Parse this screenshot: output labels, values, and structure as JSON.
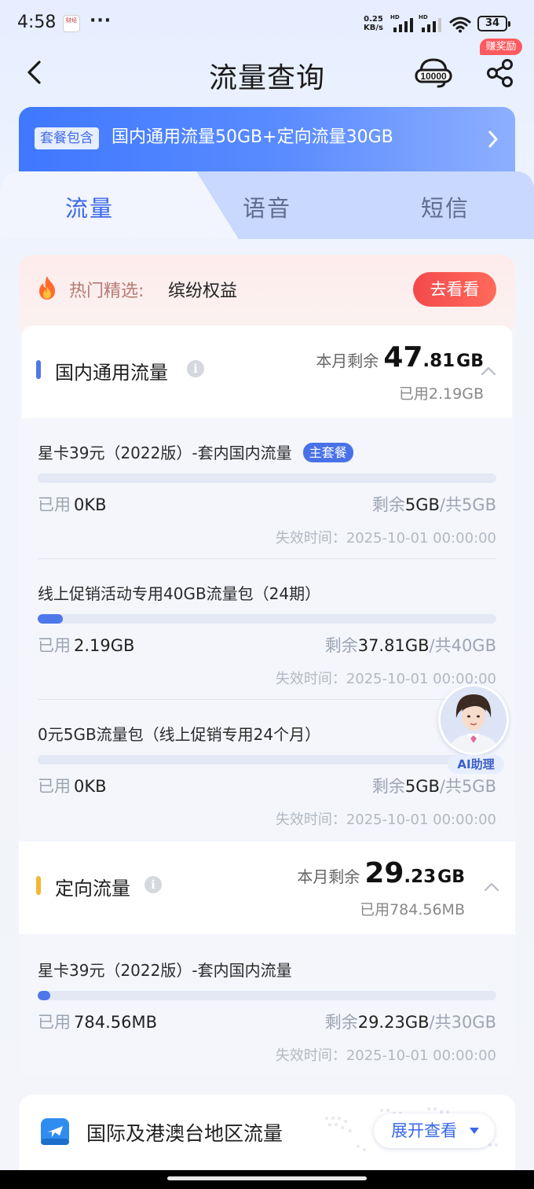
{
  "status_bar": {
    "time": "4:58",
    "more": "···",
    "app_icon_text": "财经",
    "net_speed_value": "0.25",
    "net_speed_unit": "KB/s",
    "sim1_label": "HD",
    "sim2_label": "HD",
    "battery": "34"
  },
  "nav": {
    "title": "流量查询",
    "service_icon": "10000-service-icon",
    "reward_badge": "赚奖励"
  },
  "package": {
    "tag": "套餐包含",
    "text": "国内通用流量50GB+定向流量30GB"
  },
  "tabs": [
    {
      "label": "流量",
      "active": true
    },
    {
      "label": "语音",
      "active": false
    },
    {
      "label": "短信",
      "active": false
    }
  ],
  "hot_pick": {
    "label": "热门精选:",
    "value": "缤纷权益",
    "button": "去看看"
  },
  "domestic": {
    "title": "国内通用流量",
    "accent_color": "#4e78ea",
    "remaining_label": "本月剩余",
    "remaining_int": "47",
    "remaining_dec": ".81",
    "remaining_unit": "GB",
    "used": "已用2.19GB",
    "items": [
      {
        "name": "星卡39元（2022版）-套内国内流量",
        "badge": "主套餐",
        "used_label": "已用",
        "used_value": "0KB",
        "remain_label": "剩余",
        "remain_value": "5GB",
        "total": "/共5GB",
        "progress": 0,
        "expire": "失效时间：2025-10-01 00:00:00"
      },
      {
        "name": "线上促销活动专用40GB流量包（24期）",
        "used_label": "已用",
        "used_value": "2.19GB",
        "remain_label": "剩余",
        "remain_value": "37.81GB",
        "total": "/共40GB",
        "progress": 0.055,
        "expire": "失效时间：2025-10-01 00:00:00"
      },
      {
        "name": "0元5GB流量包（线上促销专用24个月）",
        "used_label": "已用",
        "used_value": "0KB",
        "remain_label": "剩余",
        "remain_value": "5GB",
        "total": "/共5GB",
        "progress": 0,
        "expire": "失效时间：2025-10-01 00:00:00"
      }
    ]
  },
  "targeted": {
    "title": "定向流量",
    "accent_color": "#f5b731",
    "remaining_label": "本月剩余",
    "remaining_int": "29",
    "remaining_dec": ".23",
    "remaining_unit": "GB",
    "used": "已用784.56MB",
    "items": [
      {
        "name": "星卡39元（2022版）-套内国内流量",
        "used_label": "已用",
        "used_value": "784.56MB",
        "remain_label": "剩余",
        "remain_value": "29.23GB",
        "total": "/共30GB",
        "progress": 0.026,
        "expire": "失效时间：2025-10-01 00:00:00"
      }
    ]
  },
  "ai_assistant": {
    "label": "AI助理"
  },
  "international": {
    "title": "国际及港澳台地区流量",
    "button": "展开查看"
  }
}
